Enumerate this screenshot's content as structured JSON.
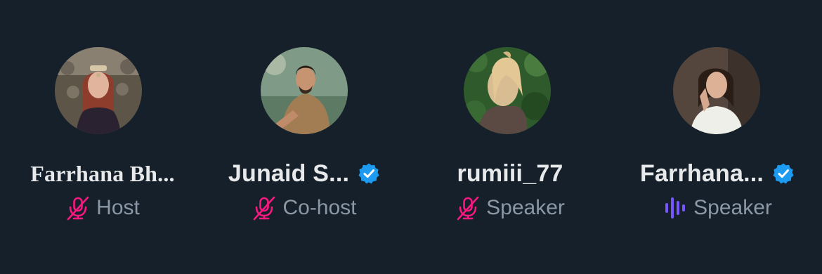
{
  "colors": {
    "background": "#15202b",
    "name_text": "#e7e9ea",
    "role_text": "#8b98a5",
    "muted_mic": "#f91880",
    "speaking_wave": "#7856ff",
    "verified_badge": "#1d9bf0"
  },
  "participants": [
    {
      "display_name": "Farrhana Bh...",
      "verified": false,
      "role": "Host",
      "status_icon": "mic-muted-icon"
    },
    {
      "display_name": "Junaid S...",
      "verified": true,
      "role": "Co-host",
      "status_icon": "mic-muted-icon"
    },
    {
      "display_name": "rumiii_77",
      "verified": false,
      "role": "Speaker",
      "status_icon": "mic-muted-icon"
    },
    {
      "display_name": "Farrhana...",
      "verified": true,
      "role": "Speaker",
      "status_icon": "speaking-wave-icon"
    }
  ]
}
